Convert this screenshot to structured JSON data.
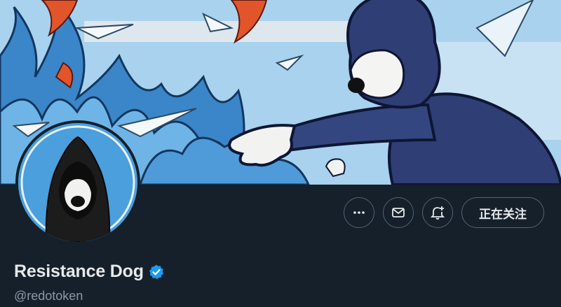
{
  "profile": {
    "display_name": "Resistance Dog",
    "handle": "@redotoken",
    "verified": true
  },
  "actions": {
    "more_icon": "more-horizontal-icon",
    "message_icon": "envelope-icon",
    "notify_icon": "bell-plus-icon",
    "follow_label": "正在关注"
  },
  "colors": {
    "background": "#15202b",
    "accent": "#1d9bf0",
    "avatar_bg": "#4b9fdc",
    "border": "#536471"
  }
}
